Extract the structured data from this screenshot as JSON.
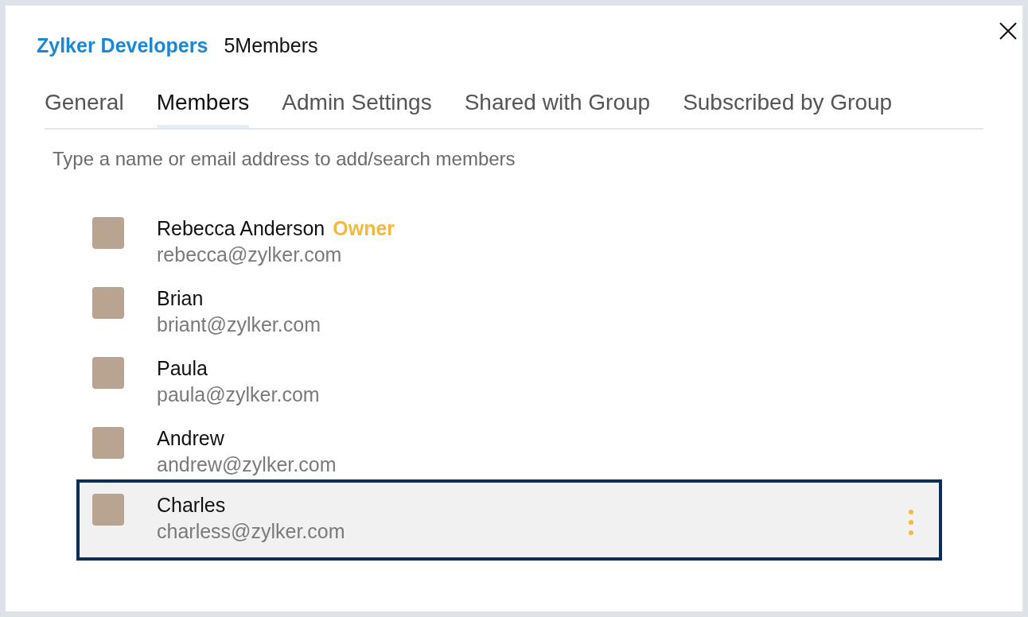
{
  "header": {
    "group_name": "Zylker Developers",
    "member_count": "5Members"
  },
  "tabs": [
    {
      "label": "General",
      "selected": false
    },
    {
      "label": "Members",
      "selected": true
    },
    {
      "label": "Admin Settings",
      "selected": false
    },
    {
      "label": "Shared with Group",
      "selected": false
    },
    {
      "label": "Subscribed by Group",
      "selected": false
    }
  ],
  "search": {
    "placeholder": "Type a name or email address to add/search members"
  },
  "members": [
    {
      "name": "Rebecca Anderson",
      "role": "Owner",
      "email": "rebecca@zylker.com",
      "selected": false
    },
    {
      "name": "Brian",
      "email": "briant@zylker.com",
      "selected": false
    },
    {
      "name": "Paula",
      "email": "paula@zylker.com",
      "selected": false
    },
    {
      "name": "Andrew",
      "email": "andrew@zylker.com",
      "selected": false
    },
    {
      "name": "Charles",
      "email": "charless@zylker.com",
      "selected": true
    }
  ]
}
